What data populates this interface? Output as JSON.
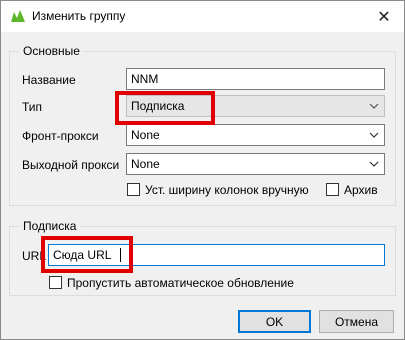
{
  "window": {
    "title": "Изменить группу",
    "close_symbol": "✕"
  },
  "main_group": {
    "title": "Основные",
    "name_label": "Название",
    "name_value": "NNM",
    "type_label": "Тип",
    "type_value": "Подписка",
    "front_proxy_label": "Фронт-прокси",
    "front_proxy_value": "None",
    "exit_proxy_label": "Выходной прокси",
    "exit_proxy_value": "None",
    "manual_width_label": "Уст. ширину колонок вручную",
    "manual_width_checked": false,
    "archive_label": "Архив",
    "archive_checked": false
  },
  "subscription_group": {
    "title": "Подписка",
    "url_label": "URL",
    "url_value": "Сюда URL",
    "skip_update_label": "Пропустить автоматическое обновление",
    "skip_update_checked": false
  },
  "buttons": {
    "ok_label": "OK",
    "cancel_label": "Отмена"
  },
  "colors": {
    "highlight": "#e00000",
    "focus": "#0078d7",
    "app_icon": "#5cb82a"
  },
  "icons": {
    "app": "leaf-icon",
    "dropdown": "chevron-down-icon",
    "close": "close-icon"
  }
}
